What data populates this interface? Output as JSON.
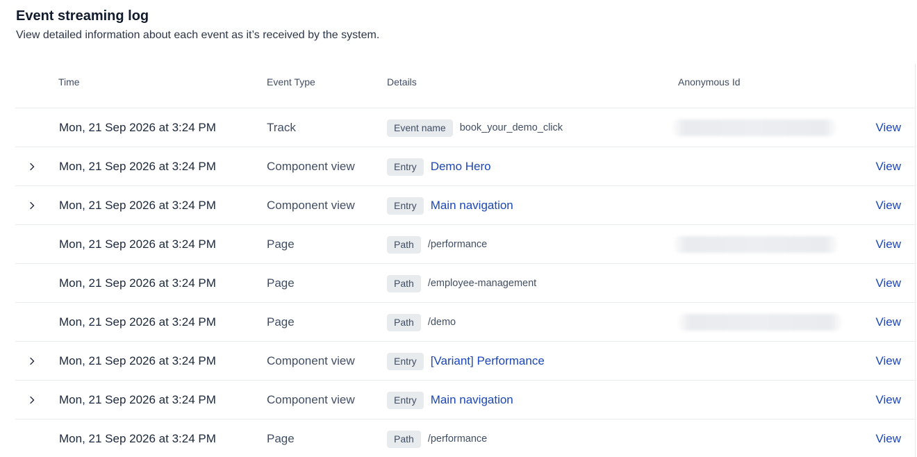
{
  "header": {
    "title": "Event streaming log",
    "subtitle": "View detailed information about each event as it’s received by the system."
  },
  "table": {
    "columns": {
      "time": "Time",
      "event_type": "Event Type",
      "details": "Details",
      "anonymous_id": "Anonymous Id"
    },
    "rows": [
      {
        "time": "Mon, 21 Sep 2026 at 3:24 PM",
        "type": "Track",
        "tag": "Event name",
        "value": "book_your_demo_click",
        "value_is_link": false,
        "expandable": false,
        "anon_blurred": true,
        "action": "View"
      },
      {
        "time": "Mon, 21 Sep 2026 at 3:24 PM",
        "type": "Component view",
        "tag": "Entry",
        "value": "Demo Hero",
        "value_is_link": true,
        "expandable": true,
        "anon_blurred": false,
        "action": "View"
      },
      {
        "time": "Mon, 21 Sep 2026 at 3:24 PM",
        "type": "Component view",
        "tag": "Entry",
        "value": "Main navigation",
        "value_is_link": true,
        "expandable": true,
        "anon_blurred": false,
        "action": "View"
      },
      {
        "time": "Mon, 21 Sep 2026 at 3:24 PM",
        "type": "Page",
        "tag": "Path",
        "value": "/performance",
        "value_is_link": false,
        "expandable": false,
        "anon_blurred": true,
        "action": "View"
      },
      {
        "time": "Mon, 21 Sep 2026 at 3:24 PM",
        "type": "Page",
        "tag": "Path",
        "value": "/employee-management",
        "value_is_link": false,
        "expandable": false,
        "anon_blurred": false,
        "action": "View"
      },
      {
        "time": "Mon, 21 Sep 2026 at 3:24 PM",
        "type": "Page",
        "tag": "Path",
        "value": "/demo",
        "value_is_link": false,
        "expandable": false,
        "anon_blurred": true,
        "action": "View"
      },
      {
        "time": "Mon, 21 Sep 2026 at 3:24 PM",
        "type": "Component view",
        "tag": "Entry",
        "value": "[Variant] Performance",
        "value_is_link": true,
        "expandable": true,
        "anon_blurred": false,
        "action": "View"
      },
      {
        "time": "Mon, 21 Sep 2026 at 3:24 PM",
        "type": "Component view",
        "tag": "Entry",
        "value": "Main navigation",
        "value_is_link": true,
        "expandable": true,
        "anon_blurred": false,
        "action": "View"
      },
      {
        "time": "Mon, 21 Sep 2026 at 3:24 PM",
        "type": "Page",
        "tag": "Path",
        "value": "/performance",
        "value_is_link": false,
        "expandable": false,
        "anon_blurred": false,
        "action": "View"
      }
    ]
  },
  "icons": {
    "expand": "chevron-right-icon"
  },
  "colors": {
    "link": "#1a46b8",
    "tag_bg": "#e7ebee",
    "border": "#e7ebee"
  }
}
